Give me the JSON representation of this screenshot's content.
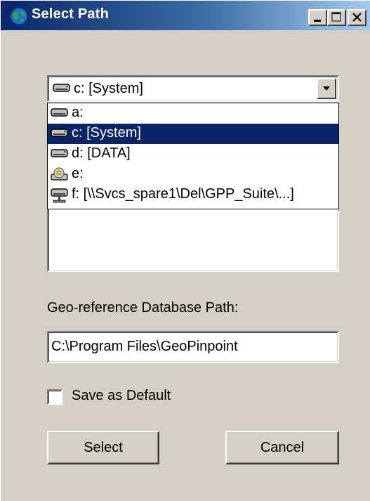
{
  "window": {
    "title": "Select Path",
    "app_icon": "globe-icon",
    "controls": [
      "minimize",
      "maximize",
      "close"
    ]
  },
  "drive_combo": {
    "selected_label": "c: [System]",
    "selected_icon": "hard-drive-icon"
  },
  "drive_dropdown": {
    "items": [
      {
        "label": "a:",
        "icon": "floppy-drive-icon",
        "selected": false
      },
      {
        "label": "c: [System]",
        "icon": "hard-drive-icon",
        "selected": true
      },
      {
        "label": "d: [DATA]",
        "icon": "hard-drive-icon",
        "selected": false
      },
      {
        "label": "e:",
        "icon": "cd-drive-icon",
        "selected": false
      },
      {
        "label": "f: [\\\\Svcs_spare1\\Del\\GPP_Suite\\...]",
        "icon": "network-drive-icon",
        "selected": false
      }
    ]
  },
  "database_path": {
    "label": "Geo-reference Database Path:",
    "value": "C:\\Program Files\\GeoPinpoint"
  },
  "save_default": {
    "label": "Save as Default",
    "checked": false
  },
  "buttons": {
    "select_label": "Select",
    "cancel_label": "Cancel"
  },
  "colors": {
    "title_gradient_start": "#0a246a",
    "title_gradient_end": "#a6caf0",
    "selection": "#0a246a",
    "face": "#d4d0c8"
  }
}
